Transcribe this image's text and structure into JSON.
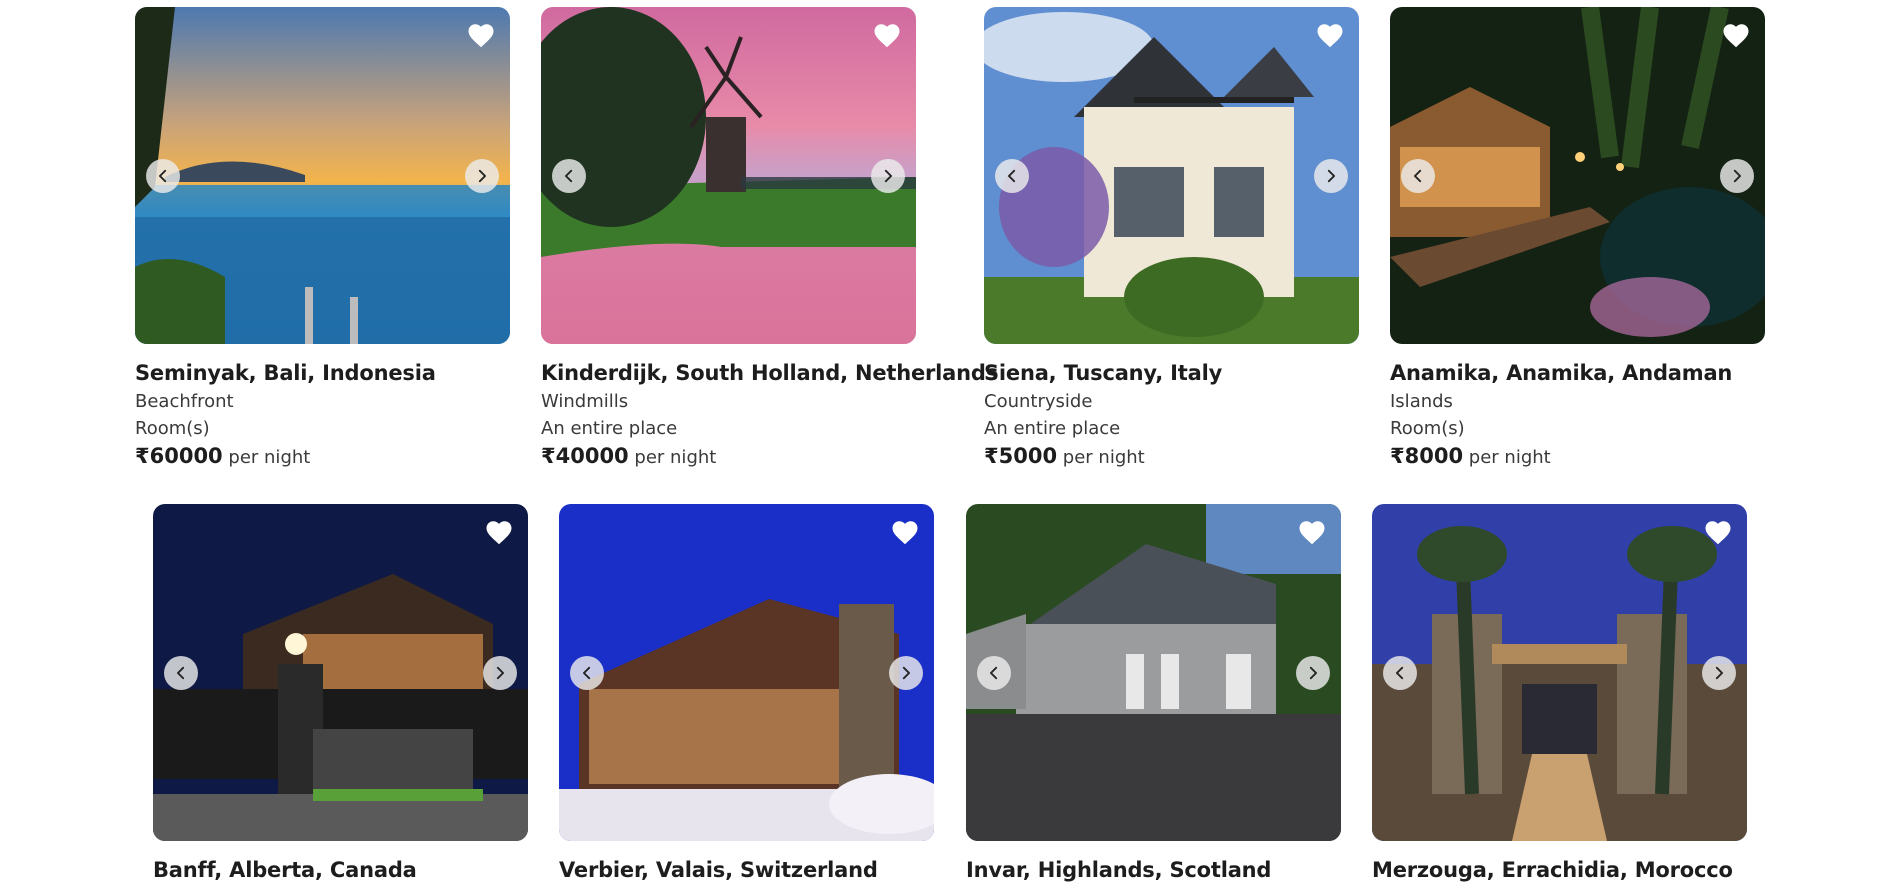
{
  "listings": [
    {
      "location": "Seminyak, Bali, Indonesia",
      "category": "Beachfront",
      "type": "Room(s)",
      "price": "₹60000",
      "per": "per night",
      "image_icon": "beach-pool-photo"
    },
    {
      "location": "Kinderdijk, South Holland, Netherlands",
      "category": "Windmills",
      "type": "An entire place",
      "price": "₹40000",
      "per": "per night",
      "image_icon": "windmill-sunset-photo"
    },
    {
      "location": "Siena, Tuscany, Italy",
      "category": "Countryside",
      "type": "An entire place",
      "price": "₹5000",
      "per": "per night",
      "image_icon": "villa-photo"
    },
    {
      "location": "Anamika, Anamika, Andaman",
      "category": "Islands",
      "type": "Room(s)",
      "price": "₹8000",
      "per": "per night",
      "image_icon": "island-resort-night-photo"
    },
    {
      "location": "Banff, Alberta, Canada",
      "image_icon": "lodge-night-photo"
    },
    {
      "location": "Verbier, Valais, Switzerland",
      "image_icon": "ski-chalet-photo"
    },
    {
      "location": "Invar, Highlands, Scotland",
      "image_icon": "stone-cottage-photo"
    },
    {
      "location": "Merzouga, Errachidia, Morocco",
      "image_icon": "desert-riad-photo"
    }
  ],
  "icons": {
    "favorite": "heart-icon",
    "previous": "chevron-left-icon",
    "next": "chevron-right-icon"
  },
  "colors": {
    "text": "#222222",
    "muted": "#3a3a3a",
    "heart": "#ffffff",
    "nav_button": "#ebebeb"
  }
}
